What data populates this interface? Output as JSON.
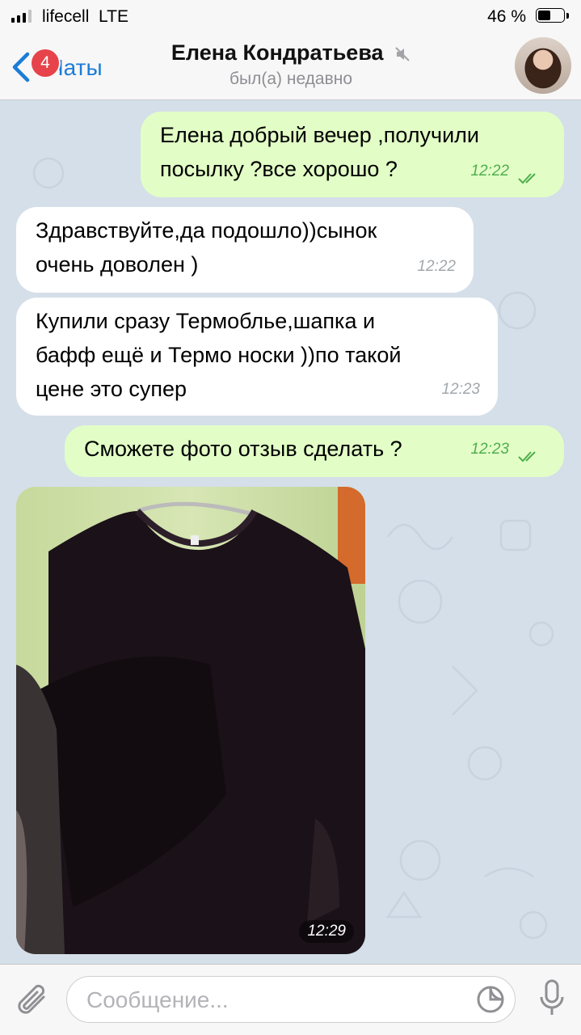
{
  "status": {
    "carrier": "lifecell",
    "network": "LTE",
    "battery": "46 %"
  },
  "nav": {
    "back_label": "Чаты",
    "unread_badge": "4",
    "title": "Елена Кондратьева",
    "subtitle": "был(а) недавно"
  },
  "messages": [
    {
      "direction": "out",
      "text": "Елена добрый вечер ,получили\nпосылку ?все хорошо ?",
      "time": "12:22",
      "read": true
    },
    {
      "direction": "in",
      "text": "Здравствуйте,да подошло))сынок\nочень доволен )",
      "time": "12:22"
    },
    {
      "direction": "in",
      "text": "Купили сразу Термоблье,шапка и\nбафф ещё и Термо носки ))по такой\nцене это супер",
      "time": "12:23"
    },
    {
      "direction": "out",
      "text": "Сможете фото отзыв сделать ?",
      "time": "12:23",
      "read": true
    },
    {
      "direction": "in",
      "type": "photo",
      "time": "12:29"
    }
  ],
  "composer": {
    "placeholder": "Сообщение..."
  },
  "colors": {
    "accent": "#1c7cd6",
    "badge": "#e6434a",
    "outgoing_bubble": "#e2fec6",
    "incoming_bubble": "#ffffff",
    "read_checks": "#4fae4e"
  }
}
